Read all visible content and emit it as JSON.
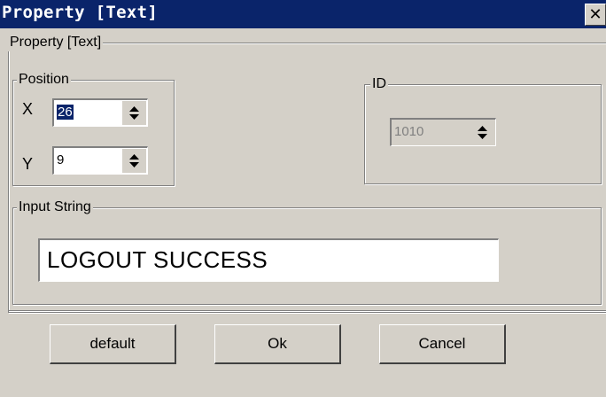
{
  "window": {
    "title": "Property  [Text]",
    "close_glyph": "✕"
  },
  "property_group": {
    "legend": "Property  [Text]"
  },
  "position_group": {
    "legend": "Position",
    "x_label": "X",
    "x_value": "26",
    "y_label": "Y",
    "y_value": "9"
  },
  "id_group": {
    "legend": "ID",
    "id_value": "1010"
  },
  "input_group": {
    "legend": "Input String",
    "value": "LOGOUT SUCCESS"
  },
  "buttons": {
    "default_label": "default",
    "ok_label": "Ok",
    "cancel_label": "Cancel"
  },
  "colors": {
    "titlebar": "#0a246a",
    "dialog_bg": "#d4d0c8",
    "selection": "#0a246a"
  },
  "icons": {
    "close": "close-icon",
    "spinner": "spinner-arrows-icon"
  }
}
